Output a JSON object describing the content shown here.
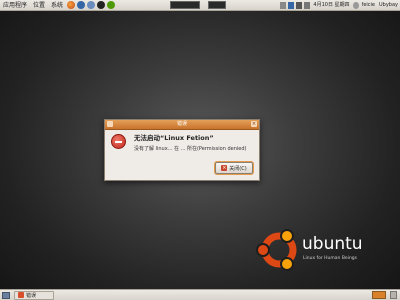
{
  "top_panel": {
    "menus": [
      "应用程序",
      "位置",
      "系统"
    ],
    "tray_text": [
      "4月10日 星期四",
      "feicie",
      "Ubybay"
    ]
  },
  "dialog": {
    "title": "错误",
    "heading": "无法启动“Linux Fetion”",
    "message": "没有了解 linux... 在 ... 所在(Permission denied)",
    "close_button": "关闭(C)"
  },
  "branding": {
    "wordmark": "ubuntu",
    "tagline": "Linux for Human Beings"
  },
  "bottom_panel": {
    "task_label": "错误"
  },
  "colors": {
    "dialog_titlebar": "#c8742c",
    "error_red": "#c0261a",
    "ubuntu_orange": "#dd4814"
  }
}
